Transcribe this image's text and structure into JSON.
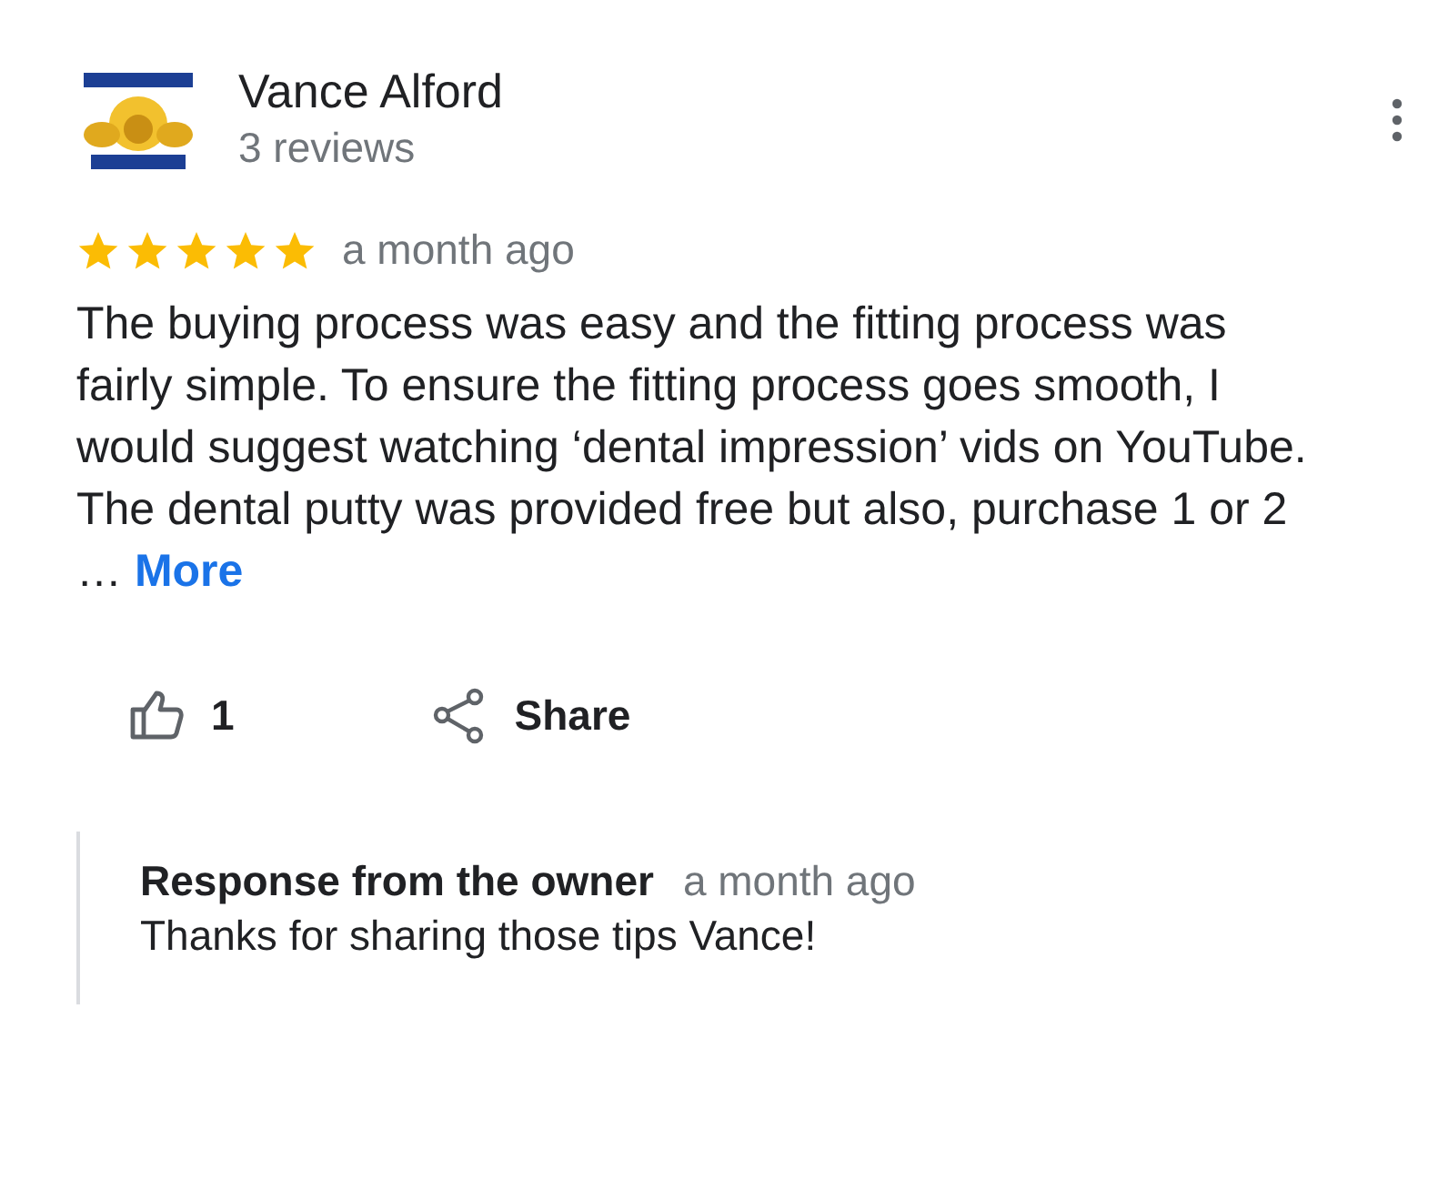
{
  "review": {
    "author": "Vance Alford",
    "author_meta": "3 reviews",
    "stars": 5,
    "time": "a month ago",
    "text": "The buying process was easy and the fitting process was fairly simple. To ensure the fitting process goes smooth, I would suggest watching ‘dental impression’ vids on YouTube. The dental putty was provided free but also, purchase 1 or 2 …",
    "more_link": "More",
    "likes": "1",
    "share": "Share",
    "owner_response": {
      "title": "Response from the owner",
      "time": "a month ago",
      "text": "Thanks for sharing those tips Vance!"
    }
  }
}
